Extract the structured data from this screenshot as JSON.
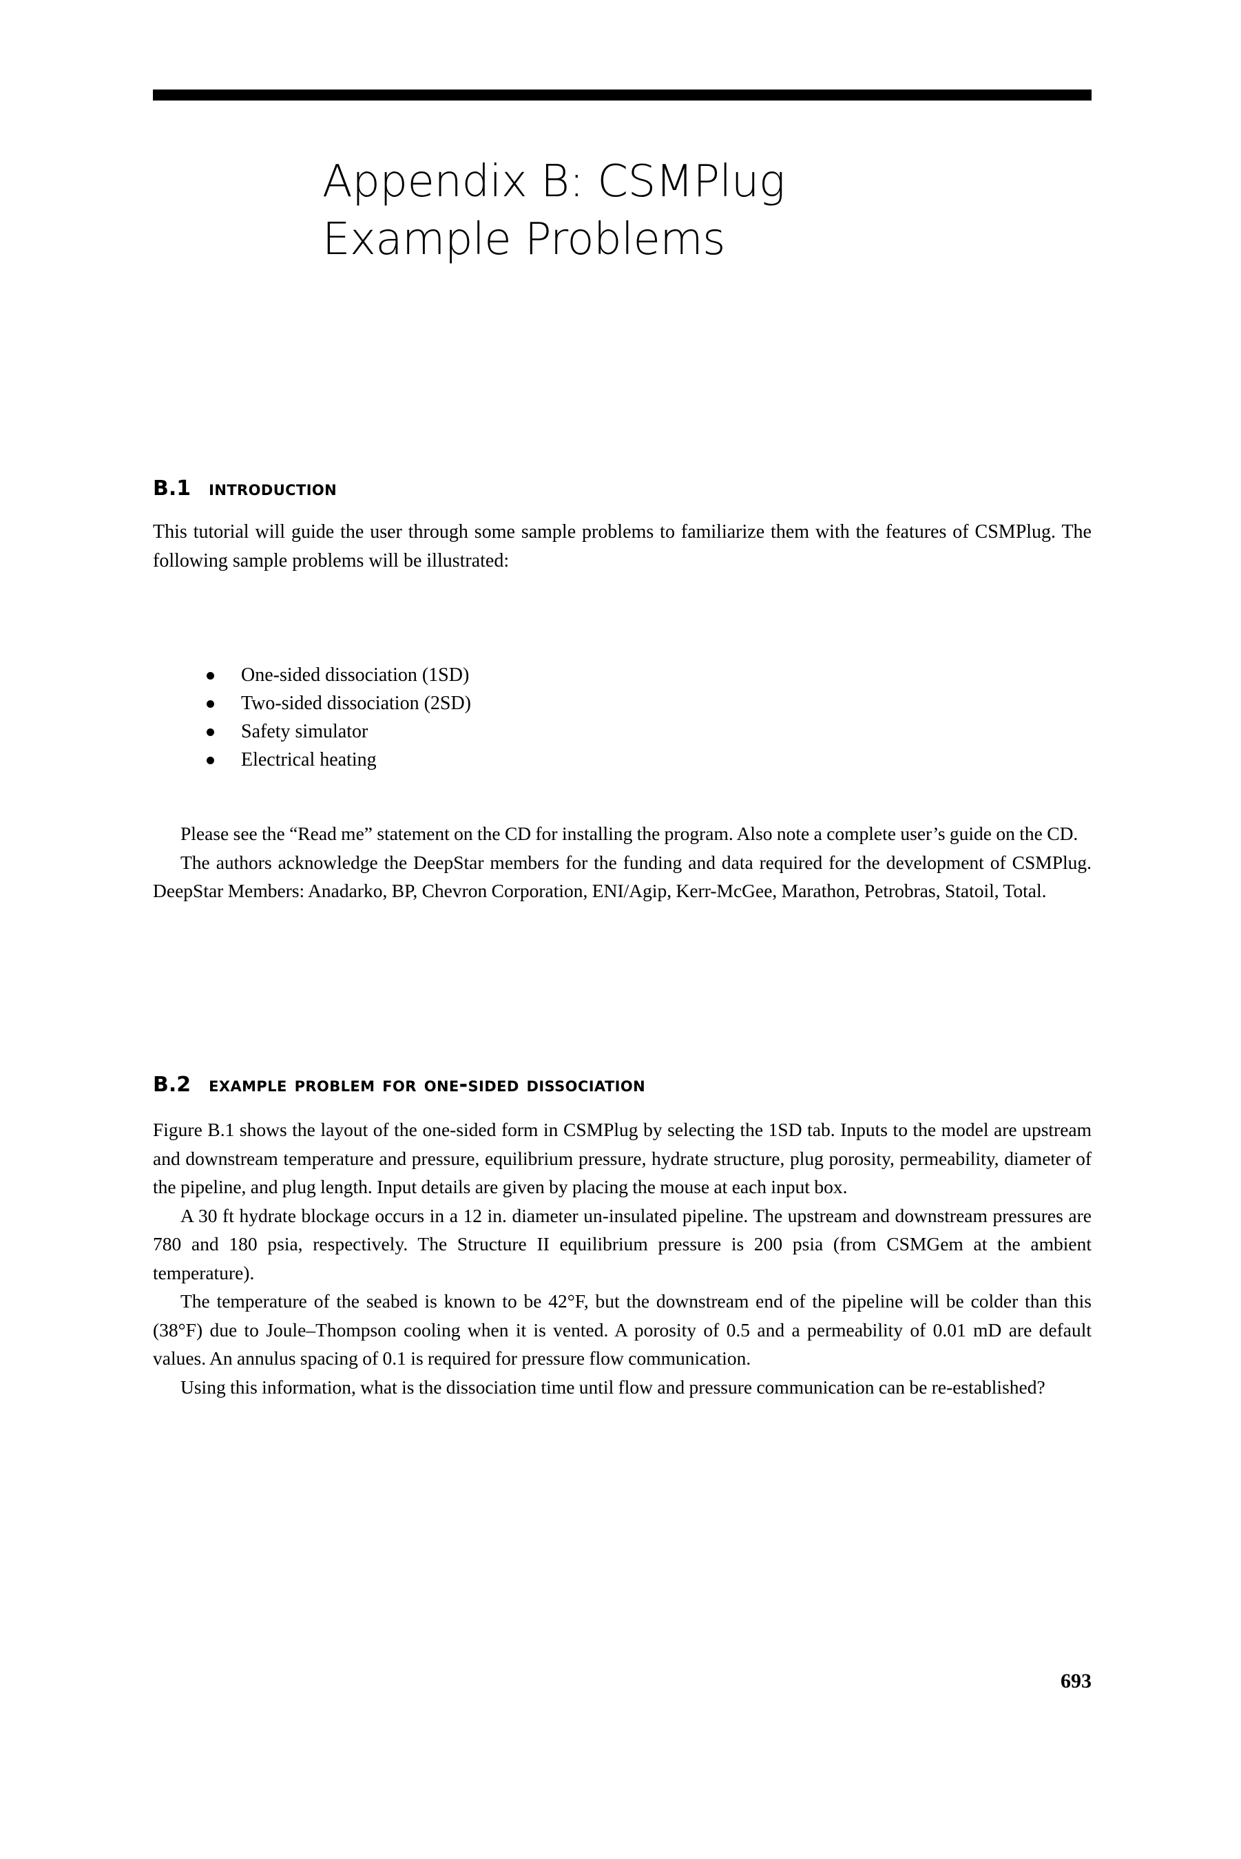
{
  "page": {
    "number": "693",
    "title_lines": [
      "Appendix B: CSMPlug",
      "Example Problems"
    ]
  },
  "sections": [
    {
      "number": "B.1",
      "title": "Introduction",
      "intro_paragraph": "This tutorial will guide the user through some sample problems to familiarize them with the features of CSMPlug. The following sample problems will be illustrated:",
      "bullets": [
        "One-sided dissociation (1SD)",
        "Two-sided dissociation (2SD)",
        "Safety simulator",
        "Electrical heating"
      ],
      "paragraphs": [
        "Please see the “Read me” statement on the CD for installing the program. Also note a complete user’s guide on the CD.",
        "The authors acknowledge the DeepStar members for the funding and data required for the development of CSMPlug. DeepStar Members: Anadarko, BP, Chevron Corporation, ENI/Agip, Kerr-McGee, Marathon, Petrobras, Statoil, Total."
      ]
    },
    {
      "number": "B.2",
      "title": "Example Problem for One-Sided Dissociation",
      "paragraphs": [
        "Figure B.1 shows the layout of the one-sided form in CSMPlug by selecting the 1SD tab. Inputs to the model are upstream and downstream temperature and pressure, equilibrium pressure, hydrate structure, plug porosity, permeability, diameter of the pipeline, and plug length. Input details are given by placing the mouse at each input box.",
        "A 30 ft hydrate blockage occurs in a 12 in. diameter un-insulated pipeline. The upstream and downstream pressures are 780 and 180 psia, respectively. The Structure II equilibrium pressure is 200 psia (from CSMGem at the ambient temperature).",
        "The temperature of the seabed is known to be 42°F, but the downstream end of the pipeline will be colder than this (38°F) due to Joule–Thompson cooling when it is vented. A porosity of 0.5 and a permeability of 0.01 mD are default values. An annulus spacing of 0.1 is required for pressure flow communication.",
        "Using this information, what is the dissociation time until flow and pressure communication can be re-established?"
      ]
    }
  ]
}
